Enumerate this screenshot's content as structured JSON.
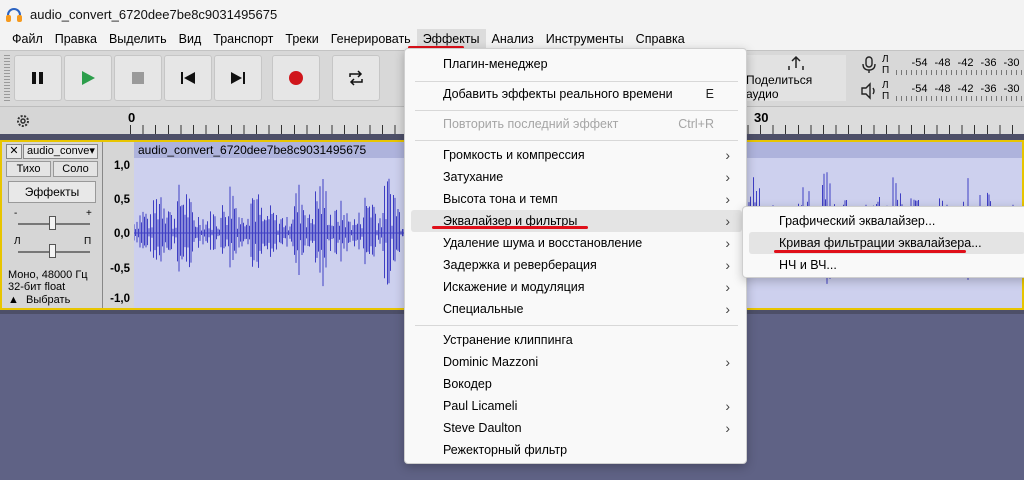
{
  "window": {
    "title": "audio_convert_6720dee7be8c9031495675"
  },
  "menubar": {
    "items": [
      "Файл",
      "Правка",
      "Выделить",
      "Вид",
      "Транспорт",
      "Треки",
      "Генерировать",
      "Эффекты",
      "Анализ",
      "Инструменты",
      "Справка"
    ],
    "active": "Эффекты"
  },
  "toolbar": {
    "share_label": "Поделиться аудио",
    "meter_scale": [
      "-54",
      "-48",
      "-42",
      "-36",
      "-30"
    ],
    "meter_lr": {
      "l": "Л",
      "r": "П"
    }
  },
  "ruler": {
    "labels": [
      "0",
      "30"
    ]
  },
  "track": {
    "name": "audio_conve",
    "mute_label": "Тихо",
    "solo_label": "Соло",
    "effects_label": "Эффекты",
    "gain_minus": "-",
    "gain_plus": "+",
    "pan_left": "Л",
    "pan_right": "П",
    "info_line1": "Моно, 48000 Гц",
    "info_line2": "32-бит float",
    "select_label": "Выбрать",
    "clip_name": "audio_convert_6720dee7be8c9031495675",
    "vscale": [
      "1,0",
      "0,5",
      "0,0",
      "-0,5",
      "-1,0"
    ]
  },
  "effects_menu": {
    "items": [
      {
        "label": "Плагин-менеджер"
      },
      {
        "label": "Добавить эффекты реального времени",
        "shortcut": "E"
      },
      {
        "label": "Повторить последний эффект",
        "shortcut": "Ctrl+R",
        "disabled": true
      },
      {
        "label": "Громкость и компрессия",
        "submenu": true
      },
      {
        "label": "Затухание",
        "submenu": true
      },
      {
        "label": "Высота тона и темп",
        "submenu": true
      },
      {
        "label": "Эквалайзер и фильтры",
        "submenu": true,
        "highlighted": true
      },
      {
        "label": "Удаление шума и восстановление",
        "submenu": true
      },
      {
        "label": "Задержка и реверберация",
        "submenu": true
      },
      {
        "label": "Искажение и модуляция",
        "submenu": true
      },
      {
        "label": "Специальные",
        "submenu": true
      },
      {
        "label": "Устранение клиппинга"
      },
      {
        "label": "Dominic Mazzoni",
        "submenu": true
      },
      {
        "label": "Вокодер"
      },
      {
        "label": "Paul Licameli",
        "submenu": true
      },
      {
        "label": "Steve Daulton",
        "submenu": true
      },
      {
        "label": "Режекторный фильтр"
      }
    ]
  },
  "eq_submenu": {
    "items": [
      {
        "label": "Графический эквалайзер..."
      },
      {
        "label": "Кривая фильтрации эквалайзера...",
        "highlighted": true
      },
      {
        "label": "НЧ и ВЧ..."
      }
    ]
  },
  "colors": {
    "accent_underline": "#e0101a",
    "waveform": "#3f3fc4",
    "track_border": "#e8c500",
    "background": "#5f6285"
  }
}
